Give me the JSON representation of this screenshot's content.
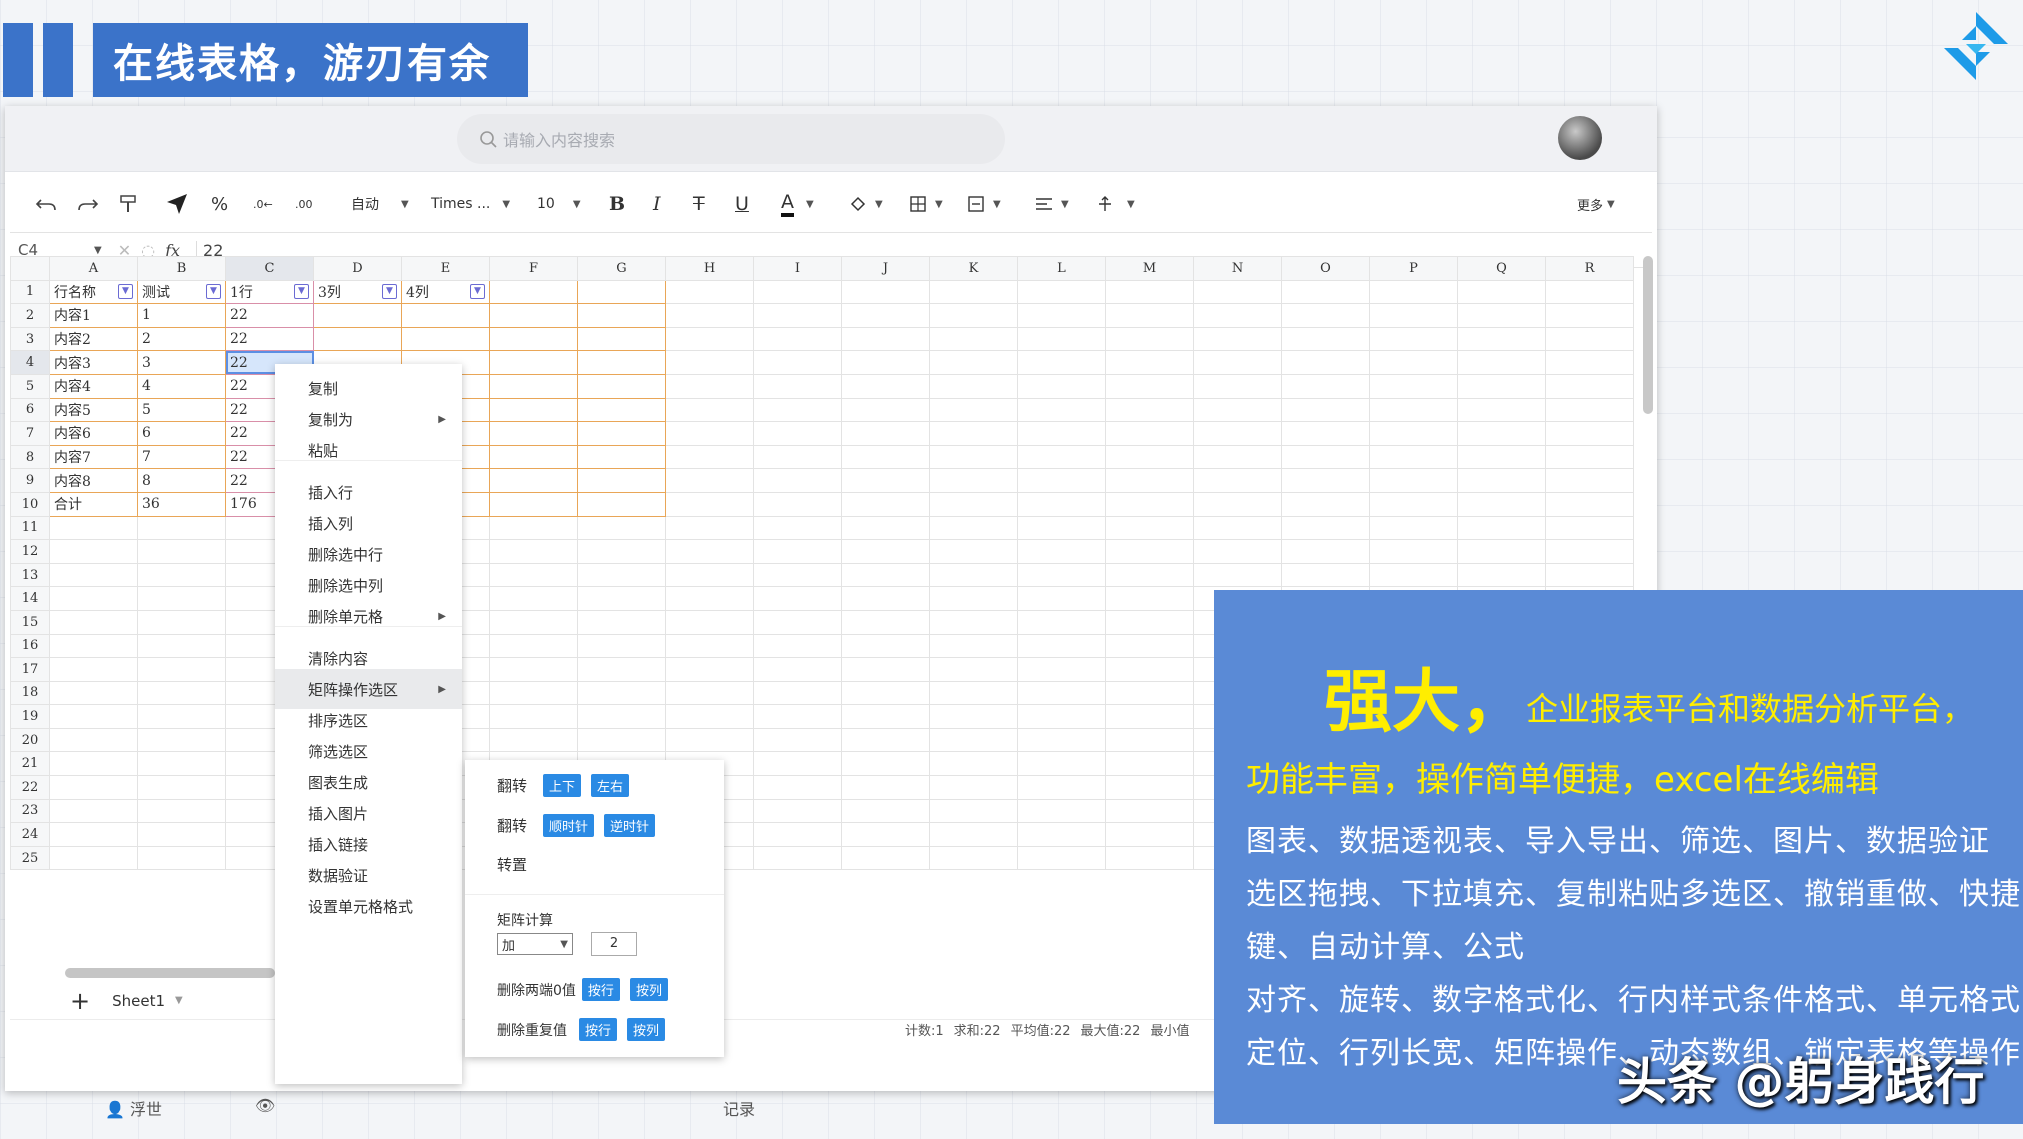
{
  "slide_title": "在线表格，游刃有余",
  "colors": {
    "accent": "#3b73c9",
    "panel": "#5a8ad6",
    "highlight_text": "#ffee00",
    "chip": "#2a8ae4"
  },
  "search": {
    "placeholder": "请输入内容搜索"
  },
  "toolbar": {
    "format_auto": "自动",
    "font_name": "Times ...",
    "font_size": "10",
    "more": "更多"
  },
  "formula_bar": {
    "cell_ref": "C4",
    "fx": "fx",
    "value": "22"
  },
  "columns": [
    "A",
    "B",
    "C",
    "D",
    "E",
    "F",
    "G",
    "H",
    "I",
    "J",
    "K",
    "L",
    "M",
    "N",
    "O",
    "P",
    "Q",
    "R"
  ],
  "rows": [
    [
      "行名称",
      "测试",
      "1行",
      "3列",
      "4列"
    ],
    [
      "内容1",
      "1",
      "22",
      "",
      ""
    ],
    [
      "内容2",
      "2",
      "22",
      "",
      ""
    ],
    [
      "内容3",
      "3",
      "22",
      "",
      ""
    ],
    [
      "内容4",
      "4",
      "22",
      "",
      ""
    ],
    [
      "内容5",
      "5",
      "22",
      "",
      ""
    ],
    [
      "内容6",
      "6",
      "22",
      "",
      ""
    ],
    [
      "内容7",
      "7",
      "22",
      "",
      ""
    ],
    [
      "内容8",
      "8",
      "22",
      "",
      ""
    ],
    [
      "合计",
      "36",
      "176",
      "",
      ""
    ],
    [
      "",
      "",
      "",
      "",
      ""
    ],
    [
      "",
      "",
      "",
      "",
      ""
    ],
    [
      "",
      "",
      "",
      "",
      ""
    ],
    [
      "",
      "",
      "",
      "",
      ""
    ],
    [
      "",
      "",
      "",
      "",
      ""
    ],
    [
      "",
      "",
      "",
      "",
      ""
    ],
    [
      "",
      "",
      "",
      "",
      ""
    ],
    [
      "",
      "",
      "",
      "",
      ""
    ],
    [
      "",
      "",
      "",
      "",
      ""
    ],
    [
      "",
      "",
      "",
      "",
      ""
    ],
    [
      "",
      "",
      "",
      "",
      ""
    ],
    [
      "",
      "",
      "",
      "",
      ""
    ],
    [
      "",
      "",
      "",
      "",
      ""
    ],
    [
      "",
      "",
      "",
      "",
      ""
    ],
    [
      "",
      "",
      "",
      "",
      ""
    ]
  ],
  "sheet_tab": "Sheet1",
  "status_bar": [
    "计数:1",
    "求和:22",
    "平均值:22",
    "最大值:22",
    "最小值"
  ],
  "bottom": {
    "user": "浮世",
    "record": "记录"
  },
  "context_menu": [
    {
      "label": "复制",
      "sub": false
    },
    {
      "label": "复制为",
      "sub": true
    },
    {
      "label": "粘贴",
      "sub": false
    },
    {
      "label": "插入行",
      "sub": false
    },
    {
      "label": "插入列",
      "sub": false
    },
    {
      "label": "删除选中行",
      "sub": false
    },
    {
      "label": "删除选中列",
      "sub": false
    },
    {
      "label": "删除单元格",
      "sub": true
    },
    {
      "label": "清除内容",
      "sub": false
    },
    {
      "label": "矩阵操作选区",
      "sub": true
    },
    {
      "label": "排序选区",
      "sub": false
    },
    {
      "label": "筛选选区",
      "sub": false
    },
    {
      "label": "图表生成",
      "sub": false
    },
    {
      "label": "插入图片",
      "sub": false
    },
    {
      "label": "插入链接",
      "sub": false
    },
    {
      "label": "数据验证",
      "sub": false
    },
    {
      "label": "设置单元格格式",
      "sub": false
    }
  ],
  "submenu": {
    "flip1": {
      "label": "翻转",
      "a": "上下",
      "b": "左右"
    },
    "flip2": {
      "label": "翻转",
      "a": "顺时针",
      "b": "逆时针"
    },
    "transpose": "转置",
    "calc": {
      "label": "矩阵计算",
      "op": "加",
      "value": "2"
    },
    "del_zero": {
      "label": "删除两端0值",
      "a": "按行",
      "b": "按列"
    },
    "del_dup": {
      "label": "删除重复值",
      "a": "按行",
      "b": "按列"
    }
  },
  "panel": {
    "title": "强大，",
    "subtitle": "企业报表平台和数据分析平台，",
    "line2": "功能丰富，操作简单便捷，excel在线编辑",
    "lines": [
      "图表、数据透视表、导入导出、筛选、图片、数据验证",
      "选区拖拽、下拉填充、复制粘贴多选区、撤销重做、快捷",
      "键、自动计算、公式",
      "对齐、旋转、数字格式化、行内样式条件格式、单元格式",
      "定位、行列长宽、矩阵操作、动态数组、锁定表格等操作"
    ]
  },
  "watermark": "头条 @躬身践行"
}
